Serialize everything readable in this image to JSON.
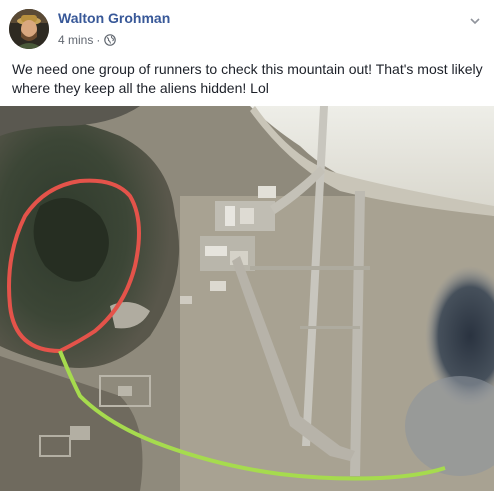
{
  "post": {
    "author": "Walton Grohman",
    "time": "4 mins",
    "separator": "·",
    "privacy_icon": "globe-icon",
    "menu_icon": "chevron-down-icon",
    "text": "We need one group of runners to check this mountain out! That's most likely where they keep all the aliens hidden! Lol"
  },
  "photo": {
    "description_icon": "satellite-map-image",
    "annotation_colors": {
      "circle": "#e4534a",
      "route": "#a6db4e"
    }
  }
}
